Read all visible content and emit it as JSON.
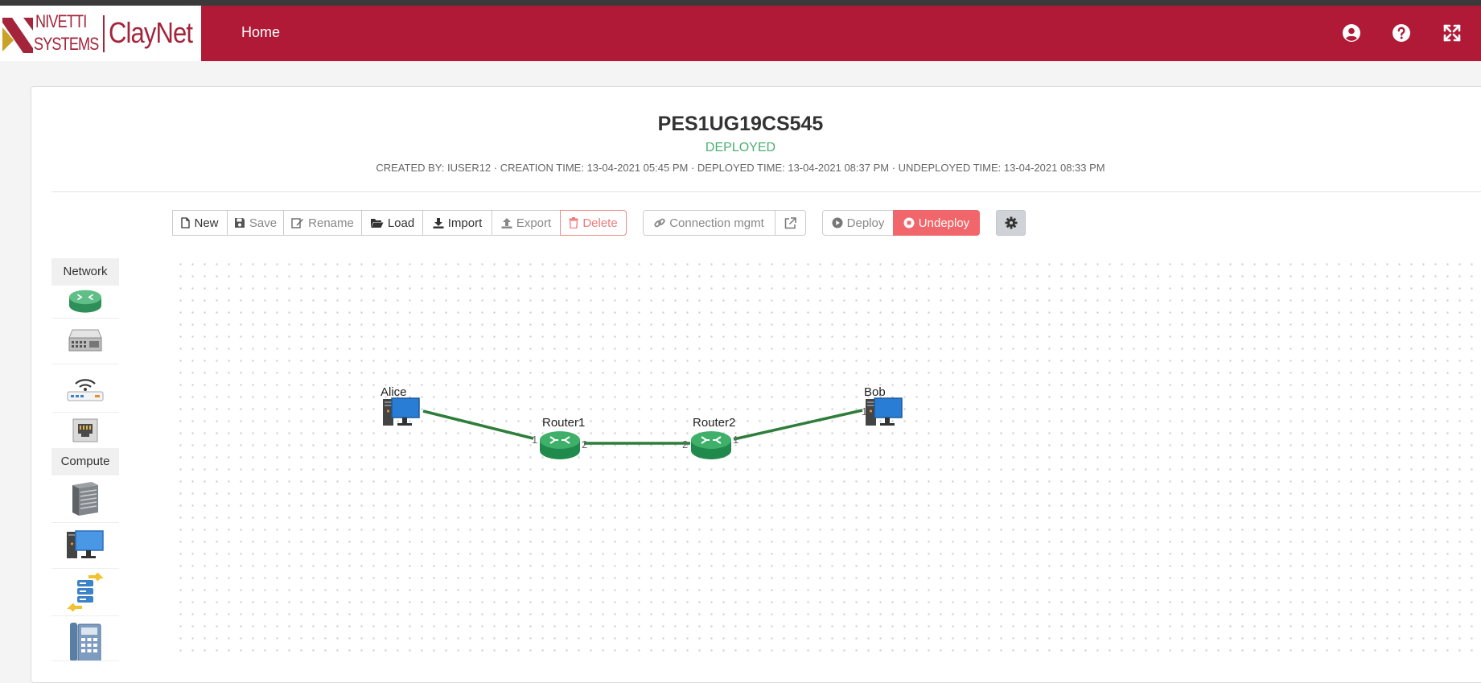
{
  "brand": {
    "logo_line1": "NIVETTI",
    "logo_line2": "SYSTEMS",
    "product": "ClayNet",
    "color": "#b01a37"
  },
  "nav": {
    "home": "Home",
    "icons": [
      "user-circle-icon",
      "question-circle-icon",
      "fullscreen-icon"
    ]
  },
  "project": {
    "title": "PES1UG19CS545",
    "status": "DEPLOYED",
    "status_color": "#4caf72",
    "meta": "CREATED BY: IUSER12 · CREATION TIME: 13-04-2021 05:45 PM · DEPLOYED TIME: 13-04-2021 08:37 PM · UNDEPLOYED TIME: 13-04-2021 08:33 PM"
  },
  "toolbar": {
    "new": "New",
    "save": "Save",
    "rename": "Rename",
    "load": "Load",
    "import": "Import",
    "export": "Export",
    "delete": "Delete",
    "connection": "Connection mgmt",
    "deploy": "Deploy",
    "undeploy": "Undeploy"
  },
  "palette": {
    "network_label": "Network",
    "compute_label": "Compute",
    "network_items": [
      "router-icon",
      "switch-icon",
      "wifi-router-icon",
      "ethernet-port-icon"
    ],
    "compute_items": [
      "server-icon",
      "pc-icon",
      "load-balancer-icon",
      "ip-phone-icon"
    ]
  },
  "topology": {
    "nodes": [
      {
        "id": "alice",
        "label": "Alice",
        "kind": "pc"
      },
      {
        "id": "router1",
        "label": "Router1",
        "kind": "router"
      },
      {
        "id": "router2",
        "label": "Router2",
        "kind": "router"
      },
      {
        "id": "bob",
        "label": "Bob",
        "kind": "pc"
      }
    ],
    "links": [
      {
        "from": "alice",
        "to": "router1",
        "to_port": "1"
      },
      {
        "from": "router1",
        "to": "router2",
        "from_port": "2",
        "to_port": "2"
      },
      {
        "from": "router2",
        "to": "bob",
        "from_port": "1",
        "to_port": "1"
      }
    ],
    "link_color": "#2f7d3b"
  }
}
